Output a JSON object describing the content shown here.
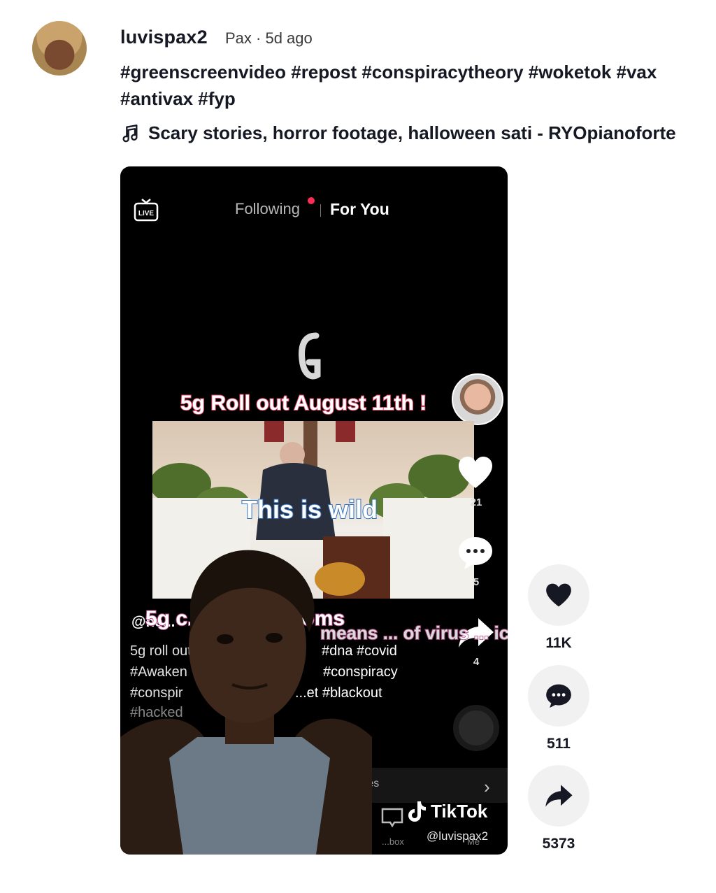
{
  "post": {
    "username": "luvispax2",
    "meta": "Pax · 5d ago",
    "caption": "#greenscreenvideo #repost #conspiracytheory #woketok #vax #antivax #fyp",
    "music": "Scary stories, horror footage, halloween sati - RYOpianoforte"
  },
  "video": {
    "tabs": {
      "following": "Following",
      "for_you": "For You"
    },
    "live_label": "LIVE",
    "overlay_title": "5g Roll out August 11th !",
    "overlay_wild": "This is wild",
    "overlay_symptoms": "5g c... ke symptoms",
    "overlay_mid": "means ... of virus ... ication",
    "video_username": "@ne...",
    "description_lines": [
      "5g roll out",
      "#Awaken",
      "#conspir",
      "#hacked"
    ],
    "hashtag_lines": [
      "#dna #covid",
      "#conspiracy",
      "...et #blackout"
    ],
    "rail_counts": {
      "likes": "21",
      "comments": "5",
      "shares": "4"
    },
    "bottom_text": "...es",
    "inbox_label": "...box",
    "me_label": "Me",
    "tiktok_label": "TikTok",
    "tiktok_handle": "@luvispax2"
  },
  "actions": {
    "likes": "11K",
    "comments": "511",
    "shares": "5373"
  },
  "icons": {
    "music": "music-note-icon",
    "live": "live-tv-icon",
    "like": "heart-icon",
    "comment": "comment-bubble-icon",
    "share": "share-arrow-icon"
  },
  "colors": {
    "accent": "#fe2c55",
    "action_bg": "#f1f1f2",
    "text": "#161823"
  }
}
